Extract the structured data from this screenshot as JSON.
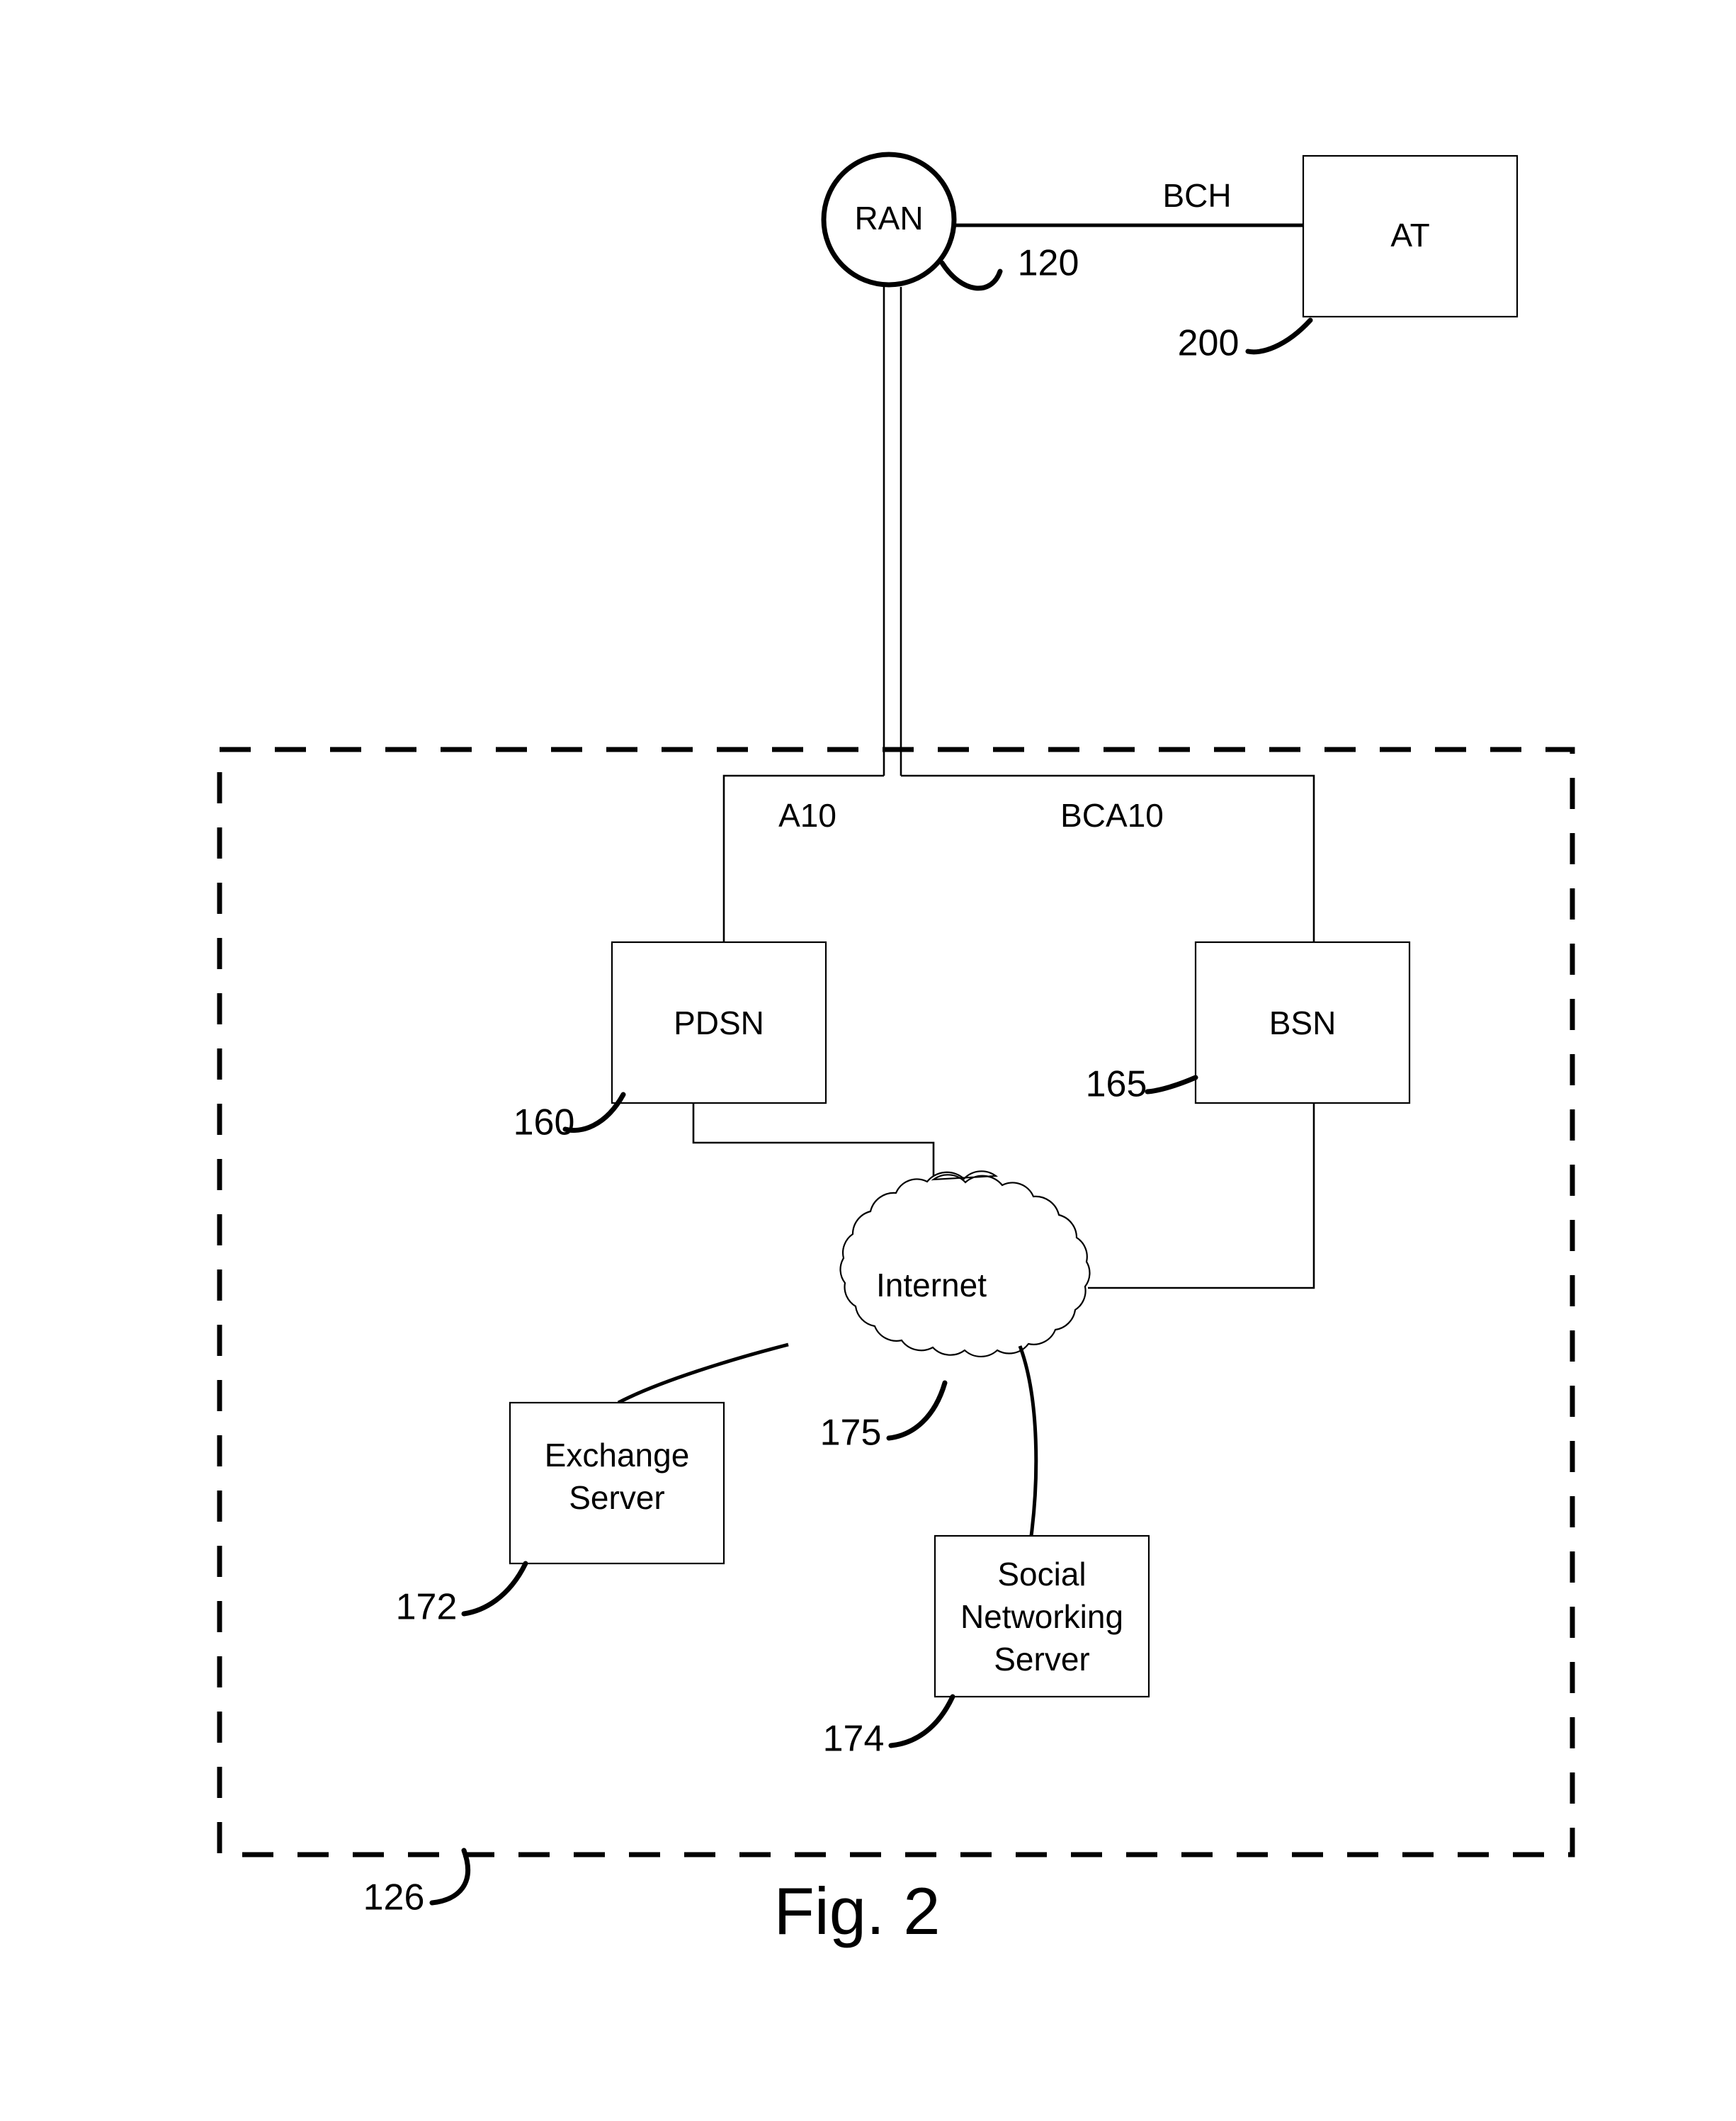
{
  "figure": {
    "caption": "Fig. 2",
    "title": "Fig. 2"
  },
  "nodes": {
    "ran": {
      "label": "RAN",
      "ref": "120",
      "shape": "circle"
    },
    "at": {
      "label": "AT",
      "ref": "200",
      "shape": "rect"
    },
    "pdsn": {
      "label": "PDSN",
      "ref": "160",
      "shape": "rect"
    },
    "bsn": {
      "label": "BSN",
      "ref": "165",
      "shape": "rect"
    },
    "internet": {
      "label": "Internet",
      "ref": "175",
      "shape": "cloud"
    },
    "exchange_server": {
      "label_line1": "Exchange",
      "label_line2": "Server",
      "ref": "172",
      "shape": "rect"
    },
    "social_server": {
      "label_line1": "Social",
      "label_line2": "Networking",
      "label_line3": "Server",
      "ref": "174",
      "shape": "rect"
    }
  },
  "edges": {
    "ran_to_at": {
      "label": "BCH"
    },
    "ran_to_pdsn": {
      "label": "A10"
    },
    "ran_to_bsn": {
      "label": "BCA10"
    }
  },
  "region": {
    "ref": "126",
    "style": "dashed"
  },
  "colors": {
    "stroke": "#000000",
    "fill": "#ffffff",
    "background": "#ffffff"
  }
}
